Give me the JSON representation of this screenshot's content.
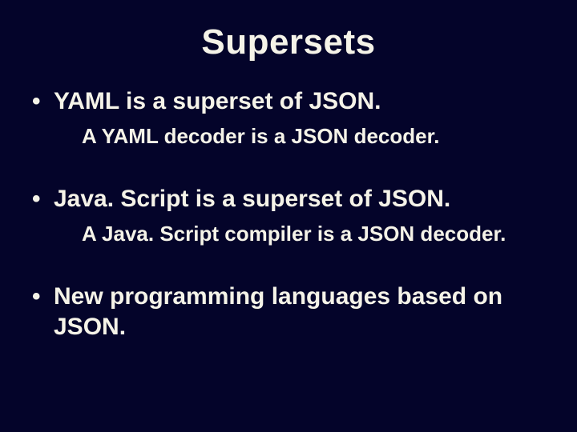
{
  "title": "Supersets",
  "bullets": [
    {
      "text": "YAML is a superset of JSON.",
      "sub": "A YAML decoder is a JSON decoder."
    },
    {
      "text": "Java. Script is a superset of JSON.",
      "sub": "A Java. Script compiler is a JSON decoder."
    },
    {
      "text": "New programming languages based on JSON.",
      "sub": ""
    }
  ]
}
